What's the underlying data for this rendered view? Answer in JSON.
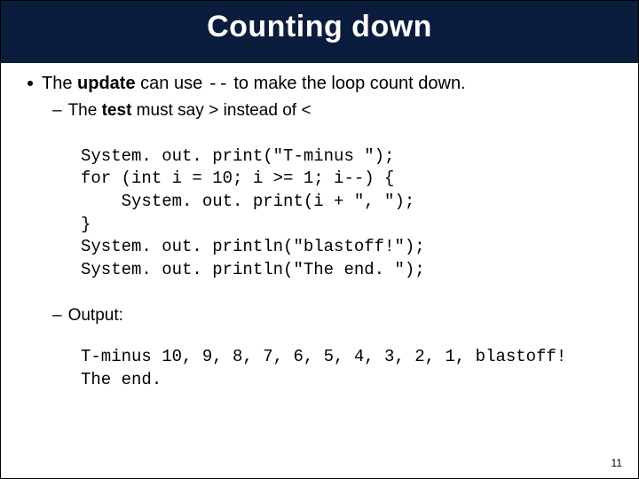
{
  "title": "Counting down",
  "bullet1": {
    "pre": "The ",
    "bold1": "update",
    "mid1": " can use ",
    "code1": "--",
    "post1": " to make the loop count down."
  },
  "sub1": {
    "pre": "The ",
    "bold1": "test",
    "mid1": " must say ",
    "code_gt": ">",
    "mid2": " instead of ",
    "code_lt": "<"
  },
  "code": "System. out. print(\"T-minus \");\nfor (int i = 10; i >= 1; i--) {\n    System. out. print(i + \", \");\n}\nSystem. out. println(\"blastoff!\");\nSystem. out. println(\"The end. \");",
  "sub2": {
    "label": "Output:"
  },
  "output": "T-minus 10, 9, 8, 7, 6, 5, 4, 3, 2, 1, blastoff!\nThe end.",
  "page": "11"
}
